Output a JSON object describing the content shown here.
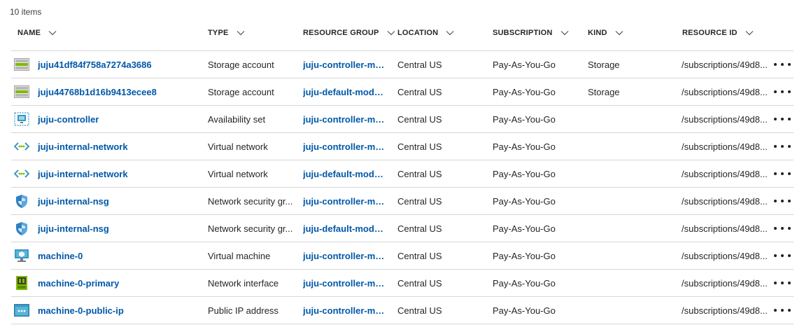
{
  "item_count": "10 items",
  "columns": {
    "name": "NAME",
    "type": "TYPE",
    "resource_group": "RESOURCE GROUP",
    "location": "LOCATION",
    "subscription": "SUBSCRIPTION",
    "kind": "KIND",
    "resource_id": "RESOURCE ID"
  },
  "rows": [
    {
      "icon": "storage-account-icon",
      "name": "juju41df84f758a7274a3686",
      "type": "Storage account",
      "resource_group": "juju-controller-mo...",
      "location": "Central US",
      "subscription": "Pay-As-You-Go",
      "kind": "Storage",
      "resource_id": "/subscriptions/49d8..."
    },
    {
      "icon": "storage-account-icon",
      "name": "juju44768b1d16b9413ecee8",
      "type": "Storage account",
      "resource_group": "juju-default-model...",
      "location": "Central US",
      "subscription": "Pay-As-You-Go",
      "kind": "Storage",
      "resource_id": "/subscriptions/49d8..."
    },
    {
      "icon": "availability-set-icon",
      "name": "juju-controller",
      "type": "Availability set",
      "resource_group": "juju-controller-mo...",
      "location": "Central US",
      "subscription": "Pay-As-You-Go",
      "kind": "",
      "resource_id": "/subscriptions/49d8..."
    },
    {
      "icon": "virtual-network-icon",
      "name": "juju-internal-network",
      "type": "Virtual network",
      "resource_group": "juju-controller-mo...",
      "location": "Central US",
      "subscription": "Pay-As-You-Go",
      "kind": "",
      "resource_id": "/subscriptions/49d8..."
    },
    {
      "icon": "virtual-network-icon",
      "name": "juju-internal-network",
      "type": "Virtual network",
      "resource_group": "juju-default-model...",
      "location": "Central US",
      "subscription": "Pay-As-You-Go",
      "kind": "",
      "resource_id": "/subscriptions/49d8..."
    },
    {
      "icon": "network-security-group-icon",
      "name": "juju-internal-nsg",
      "type": "Network security gr...",
      "resource_group": "juju-controller-mo...",
      "location": "Central US",
      "subscription": "Pay-As-You-Go",
      "kind": "",
      "resource_id": "/subscriptions/49d8..."
    },
    {
      "icon": "network-security-group-icon",
      "name": "juju-internal-nsg",
      "type": "Network security gr...",
      "resource_group": "juju-default-model...",
      "location": "Central US",
      "subscription": "Pay-As-You-Go",
      "kind": "",
      "resource_id": "/subscriptions/49d8..."
    },
    {
      "icon": "virtual-machine-icon",
      "name": "machine-0",
      "type": "Virtual machine",
      "resource_group": "juju-controller-mo...",
      "location": "Central US",
      "subscription": "Pay-As-You-Go",
      "kind": "",
      "resource_id": "/subscriptions/49d8..."
    },
    {
      "icon": "network-interface-icon",
      "name": "machine-0-primary",
      "type": "Network interface",
      "resource_group": "juju-controller-mo...",
      "location": "Central US",
      "subscription": "Pay-As-You-Go",
      "kind": "",
      "resource_id": "/subscriptions/49d8..."
    },
    {
      "icon": "public-ip-address-icon",
      "name": "machine-0-public-ip",
      "type": "Public IP address",
      "resource_group": "juju-controller-mo...",
      "location": "Central US",
      "subscription": "Pay-As-You-Go",
      "kind": "",
      "resource_id": "/subscriptions/49d8..."
    }
  ],
  "colors": {
    "link": "#0058a8",
    "divider": "#d6d6d6",
    "storage_green": "#7fba00",
    "network_cyan": "#3999c6",
    "shield_blue": "#2f7fbf"
  }
}
